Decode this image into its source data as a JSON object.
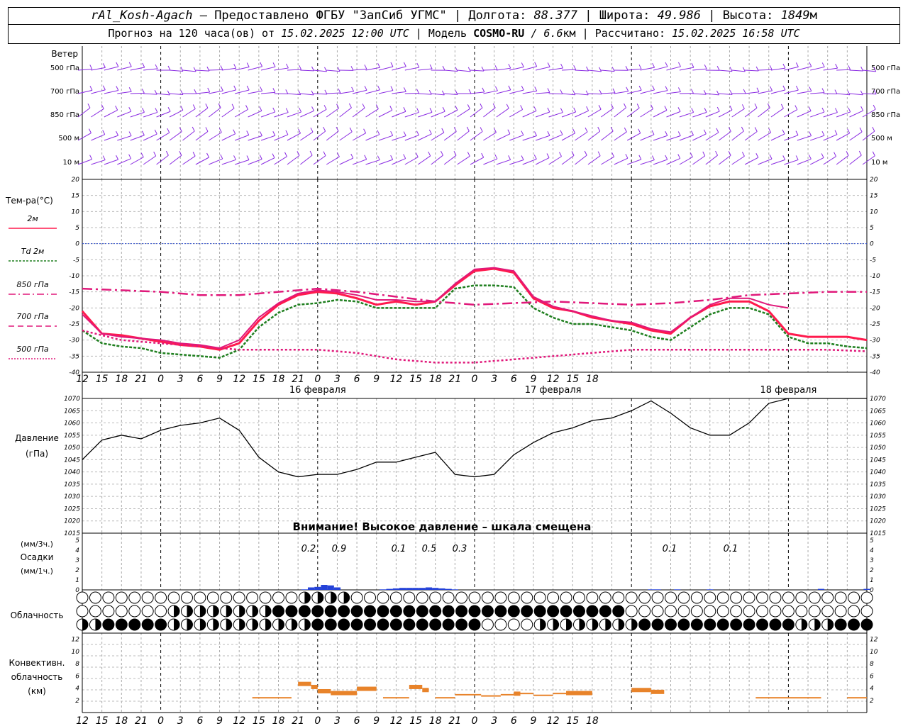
{
  "header": {
    "station": "rAl_Kosh-Agach",
    "dash": " – ",
    "provider": "Предоставлено ФГБУ \"ЗапСиб УГМС\"",
    "lon_label": "Долгота: ",
    "lon": "88.377",
    "lat_label": "Широта: ",
    "lat": "49.986",
    "alt_label": "Высота: ",
    "alt": "1849",
    "alt_unit": "м",
    "sep": " | ",
    "forecast_label": "Прогноз на 120 часа(ов) от ",
    "forecast_from": "15.02.2025 12:00 UTC",
    "model_label": "Модель ",
    "model": "COSMO-RU",
    "model_res": " / 6.6",
    "model_res_unit": "км",
    "computed_label": "Рассчитано: ",
    "computed": "15.02.2025 16:58 UTC"
  },
  "panels": {
    "wind": {
      "title": "Ветер",
      "levels": [
        "500 гПа",
        "700 гПа",
        "850 гПа",
        "500 м",
        "10 м"
      ]
    },
    "temp": {
      "title": "Тем-ра(°С)",
      "legend": [
        "2м",
        "Td 2м",
        "850 гПа",
        "700 гПа",
        "500 гПа"
      ],
      "legend_colors": [
        "#ff1a4d",
        "#1f7f1f",
        "#e0187a",
        "#e0187a",
        "#e0187a"
      ],
      "ticks": [
        "20",
        "15",
        "10",
        "5",
        "0",
        "-5",
        "-10",
        "-15",
        "-20",
        "-25",
        "-30",
        "-35",
        "-40"
      ]
    },
    "pressure": {
      "title": "Давление",
      "unit": "(гПа)",
      "ticks": [
        "1070",
        "1065",
        "1060",
        "1055",
        "1050",
        "1045",
        "1040",
        "1035",
        "1030",
        "1025",
        "1020",
        "1015"
      ],
      "warning": "Внимание! Высокое давление – шкала смещена"
    },
    "precip": {
      "unit1": "(мм/3ч.)",
      "title": "Осадки",
      "unit2": "(мм/1ч.)",
      "ticks": [
        "5",
        "4",
        "3",
        "2",
        "1",
        "0"
      ],
      "labels": [
        "0.2",
        "0.9",
        "0.1",
        "0.5",
        "0.3",
        "0.1",
        "0.1"
      ]
    },
    "cloud": {
      "title": "Облачность"
    },
    "convective": {
      "title1": "Конвективн.",
      "title2": "облачность",
      "title3": "(км)",
      "ticks": [
        "12",
        "10",
        "8",
        "6",
        "4",
        "2"
      ]
    }
  },
  "time_axis": {
    "hour_labels": [
      "12",
      "15",
      "18",
      "21",
      "0",
      "3",
      "6",
      "9",
      "12",
      "15",
      "18",
      "21",
      "0",
      "3",
      "6",
      "9",
      "12",
      "15",
      "18",
      "21",
      "0",
      "3",
      "6",
      "9",
      "12",
      "15",
      "18"
    ],
    "dates": [
      "16 февраля",
      "17 февраля",
      "18 февраля"
    ]
  },
  "chart_data": [
    {
      "type": "line",
      "title": "Тем-ра(°С)",
      "x_unit": "hours since 15.02.2025 12:00 UTC",
      "ylim": [
        -40,
        20
      ],
      "series": [
        {
          "name": "2м",
          "color": "#ff1a4d",
          "x": [
            0,
            3,
            6,
            9,
            12,
            15,
            18,
            21,
            24,
            27,
            30,
            33,
            36,
            39,
            42,
            45,
            48,
            51,
            54,
            57,
            60,
            63,
            66,
            69,
            72,
            75,
            78,
            81,
            84,
            87,
            90,
            93,
            96,
            99,
            102,
            105,
            108,
            111,
            114,
            117,
            120
          ],
          "y": [
            -21,
            -28,
            -28.5,
            -29.5,
            -30.5,
            -31.5,
            -32,
            -33,
            -31,
            -24,
            -19,
            -16,
            -15,
            -15.5,
            -17,
            -19,
            -18,
            -19,
            -18,
            -13,
            -8.5,
            -7.8,
            -9,
            -17,
            -20,
            -21,
            -23,
            -24,
            -25,
            -27,
            -28,
            -23,
            -19.5,
            -18,
            -18,
            -21,
            -28,
            -29,
            -29,
            -29,
            -30
          ]
        },
        {
          "name": "Td 2м",
          "color": "#1f7f1f",
          "x": [
            0,
            3,
            6,
            9,
            12,
            15,
            18,
            21,
            24,
            27,
            30,
            33,
            36,
            39,
            42,
            45,
            48,
            51,
            54,
            57,
            60,
            63,
            66,
            69,
            72,
            75,
            78,
            81,
            84,
            87,
            90,
            93,
            96,
            99,
            102,
            105,
            108,
            111,
            114,
            117,
            120
          ],
          "y": [
            -27,
            -31,
            -32,
            -32.5,
            -34,
            -34.5,
            -35,
            -35.5,
            -33,
            -26,
            -21.5,
            -19,
            -18.5,
            -17.5,
            -18,
            -20,
            -20,
            -20,
            -20,
            -14,
            -13,
            -13,
            -13.5,
            -20,
            -23,
            -25,
            -25,
            -26,
            -27,
            -29,
            -30,
            -26,
            -22,
            -20,
            -20,
            -22,
            -29,
            -31,
            -31,
            -32,
            -32.5
          ]
        },
        {
          "name": "850 гПа",
          "color": "#e0187a",
          "x": [
            0,
            3,
            6,
            9,
            12,
            15,
            18,
            21,
            24,
            27,
            30,
            33,
            36,
            39,
            42,
            45,
            48,
            51,
            54,
            57,
            60,
            63,
            66,
            69,
            72,
            75,
            78,
            81,
            84,
            87,
            90,
            93,
            96,
            99,
            102,
            105,
            108
          ],
          "y": [
            -22,
            -28,
            -29,
            -29.5,
            -30,
            -31,
            -31.5,
            -32.5,
            -30,
            -23,
            -18.5,
            -15.5,
            -14.5,
            -15,
            -16,
            -17.5,
            -17.5,
            -18,
            -18,
            -12.5,
            -8,
            -7.5,
            -8.5,
            -16.5,
            -19.5,
            -21,
            -22.5,
            -24,
            -24.5,
            -26.5,
            -27.5,
            -23,
            -19,
            -17,
            -17,
            -19,
            -20
          ]
        },
        {
          "name": "700 гПа",
          "color": "#e0187a",
          "x": [
            0,
            6,
            12,
            18,
            24,
            30,
            36,
            42,
            48,
            54,
            60,
            66,
            72,
            78,
            84,
            90,
            96,
            102,
            108,
            114,
            120
          ],
          "y": [
            -14,
            -14.5,
            -15,
            -16,
            -16,
            -15,
            -14,
            -15,
            -16.5,
            -18,
            -19,
            -18.5,
            -18,
            -18.5,
            -19,
            -18.5,
            -17.5,
            -16,
            -15.5,
            -15,
            -15
          ]
        },
        {
          "name": "500 гПа",
          "color": "#e0187a",
          "x": [
            0,
            6,
            12,
            18,
            24,
            30,
            36,
            42,
            48,
            54,
            60,
            66,
            72,
            78,
            84,
            90,
            96,
            102,
            108,
            114,
            120
          ],
          "y": [
            -27,
            -30,
            -31,
            -32,
            -33,
            -33,
            -33,
            -34,
            -36,
            -37,
            -37,
            -36,
            -35,
            -34,
            -33,
            -33,
            -33,
            -33,
            -33,
            -33,
            -33.5
          ]
        }
      ]
    },
    {
      "type": "line",
      "title": "Давление",
      "x_unit": "hours since 15.02.2025 12:00 UTC",
      "ylim": [
        1015,
        1070
      ],
      "series": [
        {
          "name": "",
          "color": "#000000",
          "x": [
            0,
            3,
            6,
            9,
            12,
            15,
            18,
            21,
            24,
            27,
            30,
            33,
            36,
            39,
            42,
            45,
            48,
            51,
            54,
            57,
            60,
            63,
            66,
            69,
            72,
            75,
            78,
            81,
            84,
            87,
            90,
            93,
            96,
            99,
            102,
            105,
            108,
            111,
            114,
            117,
            120
          ],
          "y": [
            1045,
            1053,
            1055,
            1053.5,
            1057,
            1059,
            1060,
            1062,
            1057,
            1046,
            1040,
            1038,
            1039,
            1039,
            1041,
            1044,
            1044,
            1046,
            1048,
            1039,
            1038,
            1039,
            1047,
            1052,
            1056,
            1058,
            1061,
            1062,
            1065,
            1069,
            1064,
            1058,
            1055,
            1055,
            1060,
            1068,
            1070,
            1070,
            1070,
            1070,
            1070
          ]
        }
      ]
    },
    {
      "type": "bar",
      "title": "Осадки",
      "x_unit": "hours since 15.02.2025 12:00 UTC",
      "ylim": [
        0,
        5
      ],
      "x": [
        34,
        35,
        36,
        37,
        38,
        39,
        46,
        47,
        48,
        49,
        50,
        51,
        52,
        53,
        54,
        55,
        56,
        57,
        87,
        88,
        91,
        96,
        113,
        120
      ],
      "values": [
        0.05,
        0.25,
        0.3,
        0.5,
        0.45,
        0.25,
        0.05,
        0.1,
        0.15,
        0.2,
        0.2,
        0.2,
        0.2,
        0.25,
        0.2,
        0.15,
        0.1,
        0.05,
        0.05,
        0.05,
        0.05,
        0.05,
        0.1,
        0.1
      ]
    },
    {
      "type": "bar",
      "title": "Конвективн. облачность (км)",
      "x_unit": "hours since 15.02.2025 12:00 UTC",
      "ylim": [
        0,
        13
      ],
      "segments": [
        [
          26,
          32,
          2.3
        ],
        [
          33,
          35,
          4.8
        ],
        [
          35,
          36,
          4.3
        ],
        [
          36,
          38,
          3.6
        ],
        [
          38,
          42,
          3.3
        ],
        [
          42,
          45,
          4.0
        ],
        [
          46,
          50,
          2.3
        ],
        [
          50,
          52,
          4.3
        ],
        [
          52,
          53,
          3.8
        ],
        [
          54,
          57,
          2.3
        ],
        [
          57,
          61,
          2.8
        ],
        [
          61,
          64,
          2.6
        ],
        [
          64,
          66,
          2.8
        ],
        [
          66,
          67,
          3.2
        ],
        [
          67,
          69,
          3.0
        ],
        [
          69,
          72,
          2.7
        ],
        [
          72,
          74,
          3.0
        ],
        [
          74,
          78,
          3.3
        ],
        [
          84,
          87,
          3.8
        ],
        [
          87,
          89,
          3.5
        ],
        [
          103,
          113,
          2.3
        ],
        [
          117,
          120,
          2.3
        ]
      ]
    }
  ]
}
